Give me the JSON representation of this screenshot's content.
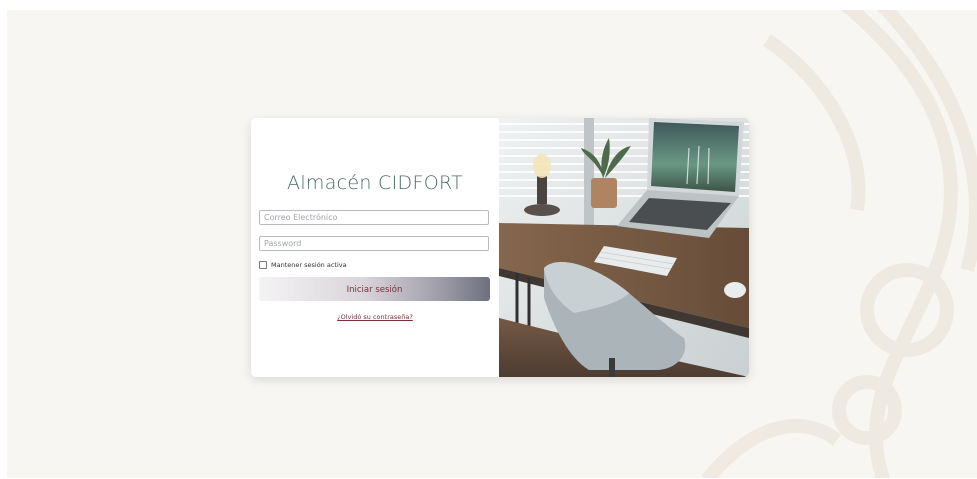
{
  "login": {
    "title": "Almacén CIDFORT",
    "email_placeholder": "Correo Electrónico",
    "password_placeholder": "Password",
    "remember_label": "Mantener sesión activa",
    "submit_label": "Iniciar sesión",
    "forgot_link": "¿Olvidó su contraseña?"
  },
  "colors": {
    "title": "#4b6b66",
    "accent": "#7a2f3a",
    "page_background": "#f8f6f2"
  },
  "images": {
    "hero": "desk-workspace-photo"
  }
}
